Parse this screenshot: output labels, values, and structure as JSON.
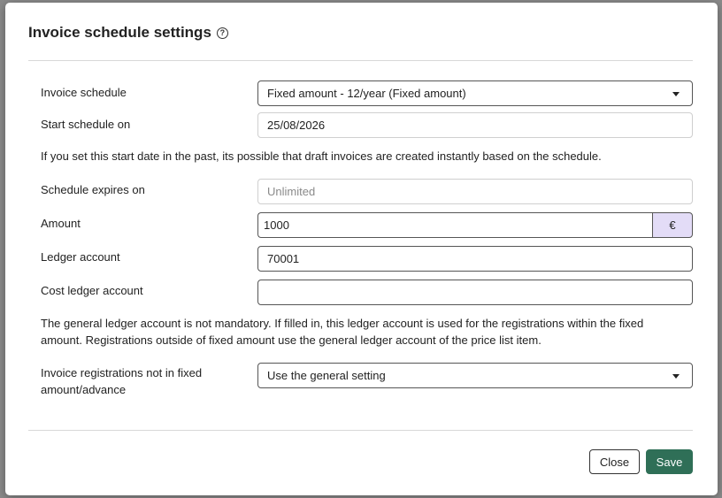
{
  "modal": {
    "title": "Invoice schedule settings",
    "help_glyph": "?"
  },
  "form": {
    "invoice_schedule": {
      "label": "Invoice schedule",
      "value": "Fixed amount - 12/year (Fixed amount)"
    },
    "start_schedule": {
      "label": "Start schedule on",
      "value": "25/08/2026"
    },
    "start_note": "If you set this start date in the past, its possible that draft invoices are created instantly based on the schedule.",
    "schedule_expires": {
      "label": "Schedule expires on",
      "placeholder": "Unlimited"
    },
    "amount": {
      "label": "Amount",
      "value": "1000",
      "currency": "€"
    },
    "ledger_account": {
      "label": "Ledger account",
      "value": "70001"
    },
    "cost_ledger_account": {
      "label": "Cost ledger account",
      "value": ""
    },
    "ledger_note_line1": "The general ledger account is not mandatory. If filled in, this ledger account is used for the registrations within the fixed",
    "ledger_note_line2": "amount. Registrations outside of fixed amount use the general ledger account of the price list item.",
    "registrations": {
      "label_line1": "Invoice registrations not in fixed",
      "label_line2": "amount/advance",
      "value": "Use the general setting"
    }
  },
  "footer": {
    "close_label": "Close",
    "save_label": "Save"
  },
  "colors": {
    "save_button": "#2f6f57",
    "currency_addon": "#e3dcf7"
  }
}
